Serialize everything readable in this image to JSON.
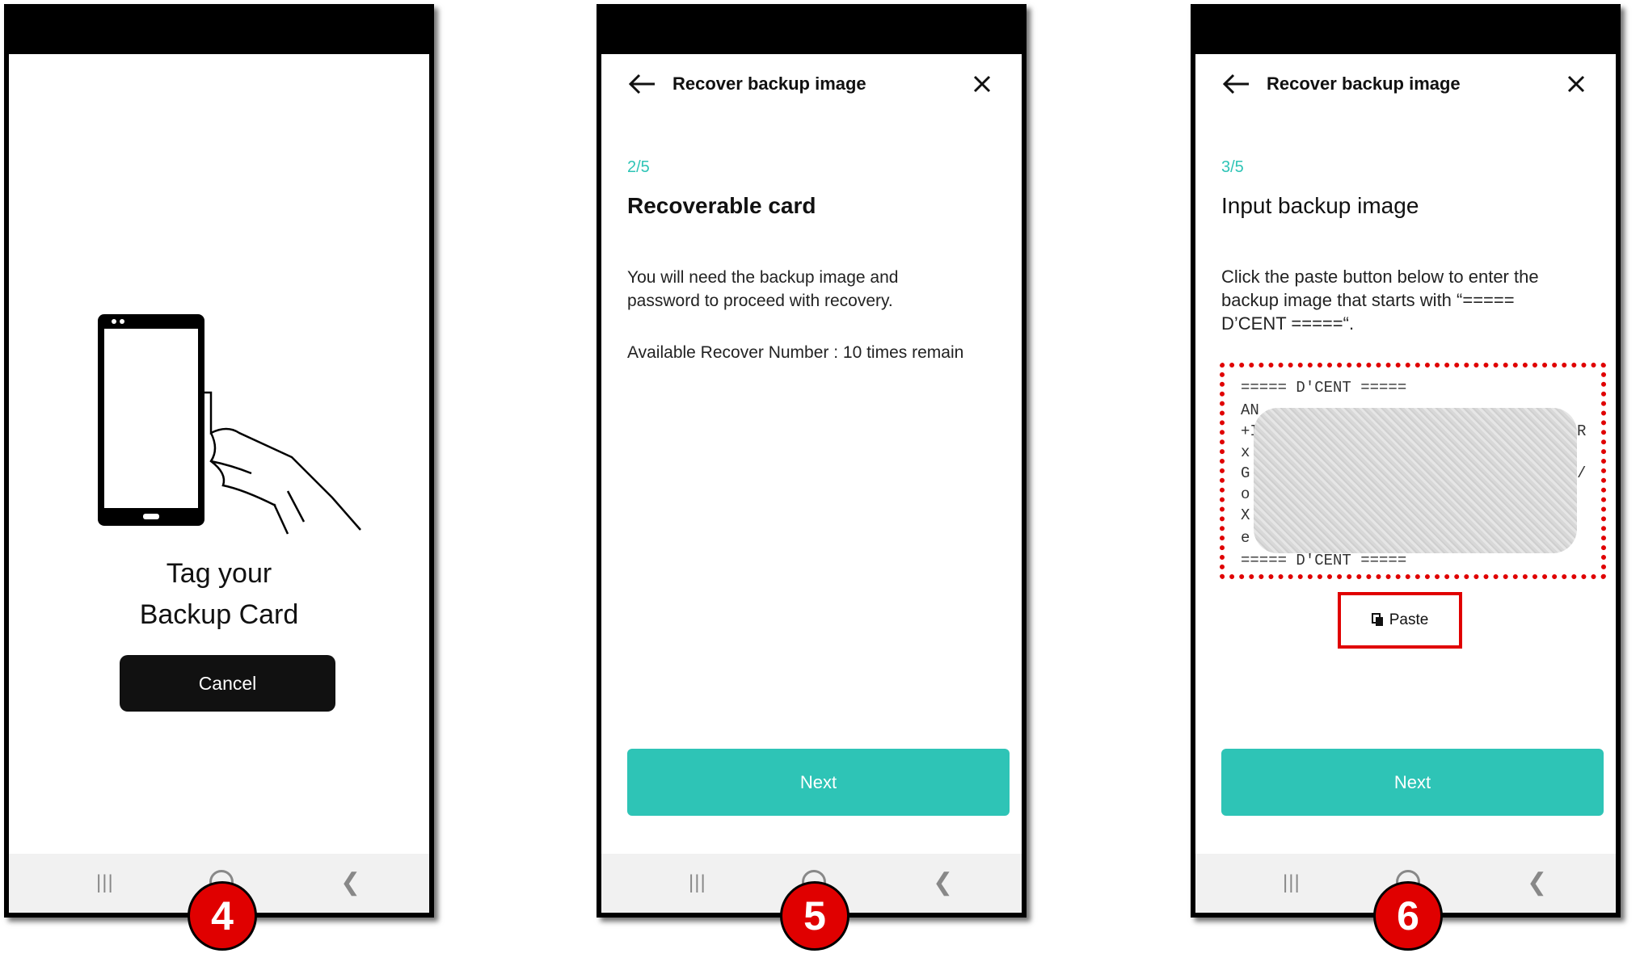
{
  "screens": [
    {
      "step_badge": "4",
      "tag_line1": "Tag your",
      "tag_line2": "Backup Card",
      "cancel_label": "Cancel"
    },
    {
      "step_badge": "5",
      "header_title": "Recover backup image",
      "step": "2/5",
      "heading": "Recoverable card",
      "body_line1": "You will need the backup image and",
      "body_line2": "password to proceed with recovery.",
      "recover_count": "Available Recover Number : 10 times remain",
      "next_label": "Next"
    },
    {
      "step_badge": "6",
      "header_title": "Recover backup image",
      "step": "3/5",
      "heading": "Input backup image",
      "body_line1": "Click the paste button below to enter the",
      "body_line2": "backup image that starts with “=====",
      "body_line3": "D’CENT =====“.",
      "backup_header": "===== D'CENT =====",
      "backup_footer": "===== D'CENT =====",
      "paste_label": "Paste",
      "next_label": "Next"
    }
  ],
  "colors": {
    "accent": "#2ec4b6",
    "highlight": "#e00000",
    "button_dark": "#111111"
  },
  "icons": [
    "back-arrow-icon",
    "close-icon",
    "copy-icon",
    "recent-apps-icon",
    "home-icon",
    "nav-back-icon",
    "phone-tag-illustration"
  ]
}
